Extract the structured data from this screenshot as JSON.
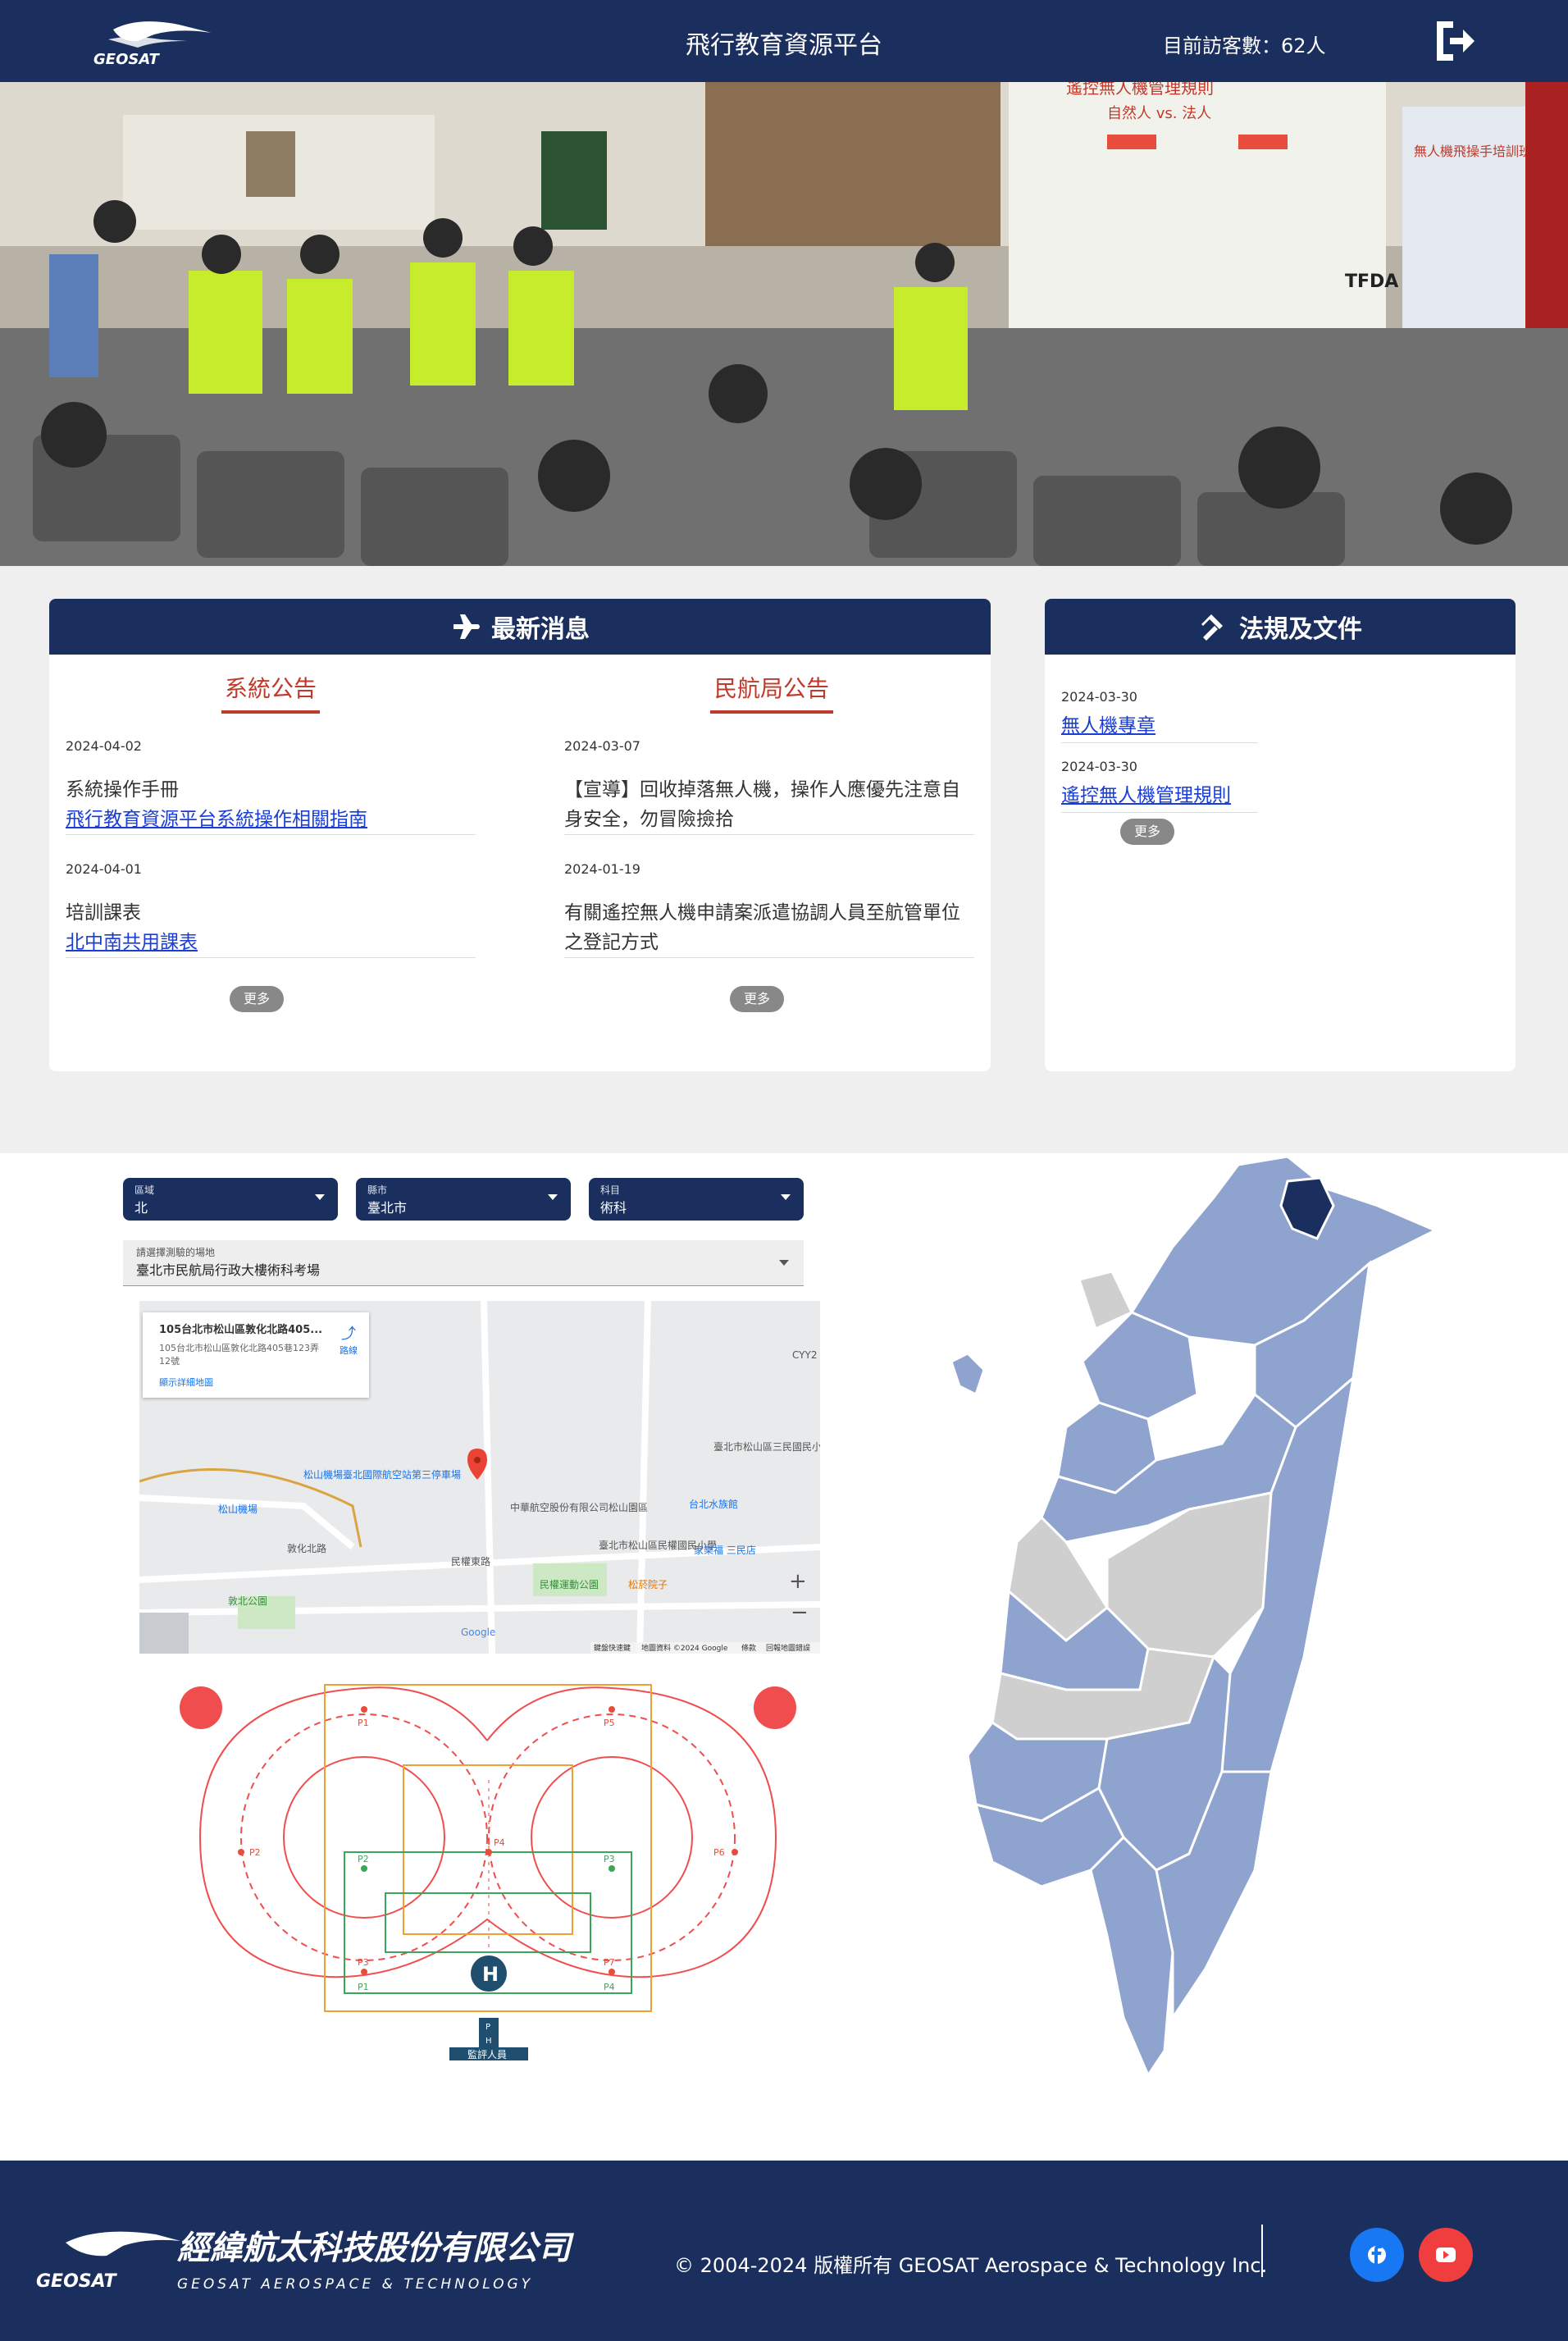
{
  "header": {
    "logo_text": "GEOSAT",
    "title": "飛行教育資源平台",
    "visitor_label": "目前訪客數：62人",
    "logout_icon": "logout-icon"
  },
  "hero": {
    "banner_heading": "遙控無人機管理規則",
    "banner_subheading": "自然人 vs. 法人",
    "rollup_title": "無人機飛操手培訓班",
    "rollup_sign": "TFDA"
  },
  "news": {
    "title": "最新消息",
    "system": {
      "title": "系統公告",
      "items": [
        {
          "date": "2024-04-02",
          "text": "系統操作手冊",
          "link": "飛行教育資源平台系統操作相關指南"
        },
        {
          "date": "2024-04-01",
          "text": "培訓課表",
          "link": "北中南共用課表"
        }
      ],
      "more": "更多"
    },
    "caa": {
      "title": "民航局公告",
      "items": [
        {
          "date": "2024-03-07",
          "text": "【宣導】回收掉落無人機，操作人應優先注意自身安全，勿冒險撿拾"
        },
        {
          "date": "2024-01-19",
          "text": "有關遙控無人機申請案派遣協調人員至航管單位之登記方式"
        }
      ],
      "more": "更多"
    }
  },
  "laws": {
    "title": "法規及文件",
    "items": [
      {
        "date": "2024-03-30",
        "link": "無人機專章"
      },
      {
        "date": "2024-03-30",
        "link": "遙控無人機管理規則"
      }
    ],
    "more": "更多"
  },
  "exam": {
    "region": {
      "label": "區域",
      "value": "北"
    },
    "county": {
      "label": "縣市",
      "value": "臺北市"
    },
    "subject": {
      "label": "科目",
      "value": "術科"
    },
    "site": {
      "label": "請選擇測驗的場地",
      "value": "臺北市民航局行政大樓術科考場"
    },
    "map_info": {
      "title": "105台北市松山區敦化北路405...",
      "address": "105台北市松山區敦化北路405巷123弄12號",
      "route": "路線",
      "large_map": "顯示詳細地圖"
    },
    "map_labels": [
      "松山機場",
      "松山機場臺北國際航空站第三停車場",
      "中華航空股份有限公司松山園區",
      "臺北市松山區三民國民小學",
      "台北水族館",
      "民權運動公園",
      "敦北公園",
      "民權東路",
      "敦化北路",
      "臺北市松山區民權國民小學",
      "家樂福 三民店",
      "松菸院子",
      "CYY2",
      "Google",
      "鍵盤快速鍵",
      "地圖資料 ©2024 Google",
      "條款",
      "回報地圖錯誤"
    ],
    "diagram": {
      "points": [
        "P1",
        "P2",
        "P3",
        "P4",
        "P5",
        "P6",
        "P7",
        "P8"
      ],
      "green_points": [
        "P1",
        "P2",
        "P3",
        "P4"
      ],
      "helipad": "H",
      "evaluator_box": [
        "P",
        "H"
      ],
      "evaluator": "監評人員"
    }
  },
  "taiwan_map": {
    "highlighted": "臺北市"
  },
  "footer": {
    "company": "經緯航太科技股份有限公司",
    "company_en": "GEOSAT AEROSPACE & TECHNOLOGY",
    "copyright": "© 2004-2024 版權所有 GEOSAT Aerospace & Technology Inc.",
    "social": [
      "facebook-icon",
      "youtube-icon"
    ]
  },
  "colors": {
    "navy": "#1b2f5e",
    "accent_red": "#c0392b",
    "map_blue": "#8fa3cf",
    "map_grey": "#cfcfcf"
  }
}
